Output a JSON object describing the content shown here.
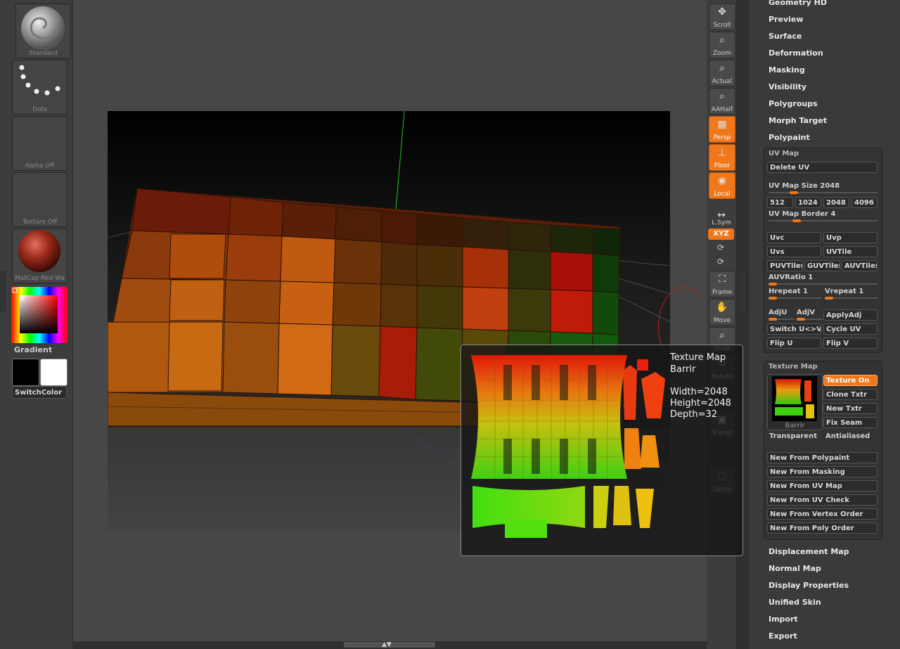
{
  "left_shelf": {
    "brush_label": "Standard",
    "stroke_label": "Dots",
    "alpha_label": "Alpha Off",
    "texture_label": "Texture Off",
    "material_label": "MatCap Red Wa",
    "gradient_label": "Gradient",
    "switch_color_label": "SwitchColor",
    "main_color": "#000000",
    "secondary_color": "#ffffff"
  },
  "tools": [
    {
      "label": "Scroll",
      "icon": "scroll-icon",
      "on": false
    },
    {
      "label": "Zoom",
      "icon": "zoom-icon",
      "on": false
    },
    {
      "label": "Actual",
      "icon": "actual-icon",
      "on": false
    },
    {
      "label": "AAHalf",
      "icon": "aahalf-icon",
      "on": false
    },
    {
      "label": "Persp",
      "icon": "perspective-icon",
      "on": true
    },
    {
      "label": "Floor",
      "icon": "floor-icon",
      "on": true
    },
    {
      "label": "Local",
      "icon": "local-icon",
      "on": true
    },
    {
      "label": "L.Sym",
      "icon": "lsym-icon",
      "on": false
    },
    {
      "label": "Frame",
      "icon": "frame-icon",
      "on": false
    },
    {
      "label": "Move",
      "icon": "move-icon",
      "on": false
    },
    {
      "label": "Scale",
      "icon": "scale-icon",
      "on": false
    },
    {
      "label": "Rotate",
      "icon": "rotate-icon",
      "on": false
    },
    {
      "label": "Transp",
      "icon": "transparency-icon",
      "on": false
    },
    {
      "label": "Lasso",
      "icon": "lasso-icon",
      "on": false
    }
  ],
  "xyz_label": "XYZ",
  "menus_top": [
    "Geometry HD",
    "Preview",
    "Surface",
    "Deformation",
    "Masking",
    "Visibility",
    "Polygroups",
    "Morph Target",
    "Polypaint"
  ],
  "uv_map": {
    "title": "UV Map",
    "delete_uv": "Delete UV",
    "size_label": "UV Map Size 2048",
    "size_value": 2048,
    "size_buttons": [
      "512",
      "1024",
      "2048",
      "4096"
    ],
    "border_label": "UV Map Border 4",
    "uvc": "Uvc",
    "uvp": "Uvp",
    "uvs": "Uvs",
    "uvtile": "UVTile",
    "puvtiles": "PUVTiles",
    "guvtiles": "GUVTiles",
    "auvtiles": "AUVTiles",
    "auvratio": "AUVRatio 1",
    "hrepeat": "Hrepeat 1",
    "vrepeat": "Vrepeat 1",
    "adju": "AdjU",
    "adjv": "AdjV",
    "applyadj": "ApplyAdj",
    "switch_uv": "Switch U<>V",
    "cycle_uv": "Cycle UV",
    "flip_u": "Flip U",
    "flip_v": "Flip V"
  },
  "texture_map": {
    "title": "Texture Map",
    "thumb_label": "Barrir",
    "texture_on": "Texture On",
    "clone_txtr": "Clone Txtr",
    "new_txtr": "New Txtr",
    "fix_seam": "Fix Seam",
    "transparent": "Transparent",
    "antialiased": "Antialiased",
    "new_buttons": [
      "New From Polypaint",
      "New From Masking",
      "New From UV Map",
      "New From UV Check",
      "New From Vertex Order",
      "New From Poly Order"
    ]
  },
  "menus_bottom": [
    "Displacement Map",
    "Normal Map",
    "Display Properties",
    "Unified Skin",
    "Import",
    "Export"
  ],
  "popup": {
    "title": "Texture Map",
    "name": "Barrir",
    "width": "Width=2048",
    "height": "Height=2048",
    "depth": "Depth=32"
  },
  "colors": {
    "accent": "#f0771a",
    "panel": "#3a3a3a",
    "canvas": "#474747"
  }
}
